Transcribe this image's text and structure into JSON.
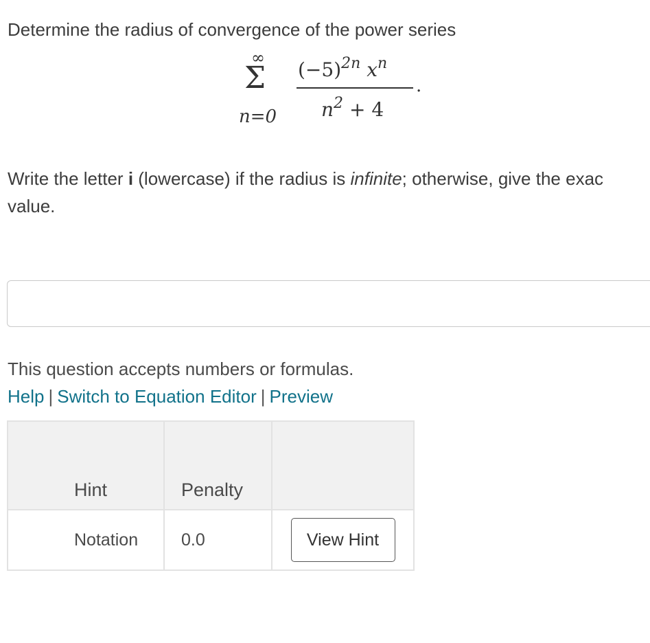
{
  "question": {
    "prompt": "Determine the radius of convergence of the power series",
    "series": {
      "sum_upper": "∞",
      "sum_symbol": "Σ",
      "sum_lower": "n=0",
      "numerator_base": "(−5)",
      "numerator_exp": "2n",
      "numerator_var": "x",
      "numerator_var_exp": "n",
      "denominator_var": "n",
      "denominator_exp": "2",
      "denominator_rest": "+ 4",
      "trailing": "."
    },
    "instruction_part1": "Write the letter ",
    "instruction_bold": "i",
    "instruction_part2": " (lowercase) if the radius is ",
    "instruction_italic": "infinite",
    "instruction_part3": "; otherwise, give the exac",
    "instruction_line2": "value."
  },
  "answer": {
    "value": "",
    "placeholder": ""
  },
  "accepts_text": "This question accepts numbers or formulas.",
  "links": {
    "help": "Help",
    "sep1": "|",
    "switch_editor": "Switch to Equation Editor",
    "sep2": "|",
    "preview": "Preview"
  },
  "hint_table": {
    "headers": [
      "Hint",
      "Penalty",
      ""
    ],
    "rows": [
      {
        "hint": "Notation",
        "penalty": "0.0",
        "action": "View Hint"
      }
    ]
  }
}
